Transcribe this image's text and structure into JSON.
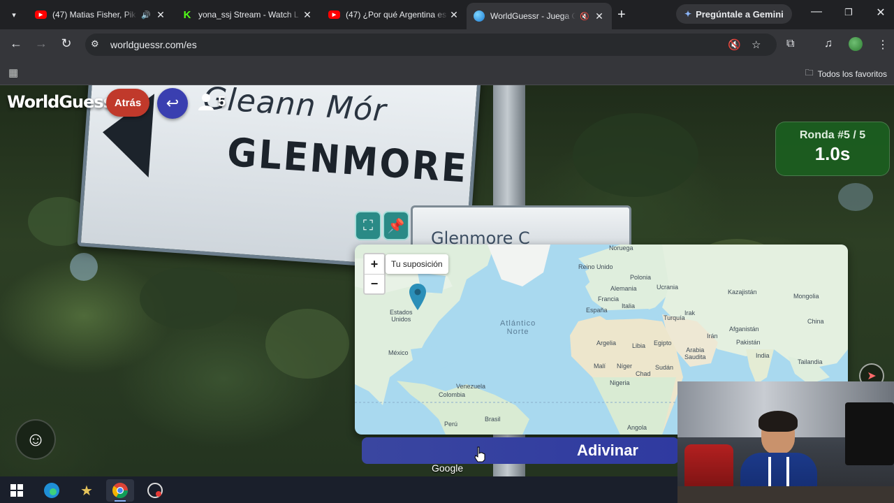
{
  "browser": {
    "tabs": [
      {
        "title": "(47) Matias Fisher, Pik",
        "favicon": "youtube-icon",
        "audio": "speaker-icon"
      },
      {
        "title": "yona_ssj Stream - Watch L",
        "favicon": "kick-icon"
      },
      {
        "title": "(47) ¿Por qué Argentina es",
        "favicon": "youtube-icon"
      },
      {
        "title": "WorldGuessr - Juega G",
        "favicon": "globe-icon",
        "audio": "muted-icon",
        "active": true
      }
    ],
    "gemini_label": "Pregúntale a Gemini",
    "url": "worldguessr.com/es",
    "bookmarks_all": "Todos los favoritos"
  },
  "game": {
    "logo": "WorldGuessr",
    "back_label": "Atrás",
    "players_count": "5",
    "round_label": "Ronda #5 / 5",
    "timer": "1.0s",
    "guess_label": "Adivinar",
    "map_attribution": "Google",
    "map": {
      "tooltip": "Tu suposición",
      "zoom_in": "+",
      "zoom_out": "−",
      "labels": {
        "noruega": "Noruega",
        "reino_unido": "Reino Unido",
        "polonia": "Polonia",
        "alemania": "Alemania",
        "ucrania": "Ucrania",
        "kazajistan": "Kazajistán",
        "mongolia": "Mongolia",
        "francia": "Francia",
        "italia": "Italia",
        "espana": "España",
        "turquia": "Turquía",
        "china": "China",
        "irak": "Irak",
        "iran": "Irán",
        "afganistan": "Afganistán",
        "pakistan": "Pakistán",
        "estados_unidos": "Estados\nUnidos",
        "atlantico_norte": "Atlántico\nNorte",
        "argelia": "Argelia",
        "libia": "Libia",
        "egipto": "Egipto",
        "arabia_saudita": "Arabia\nSaudita",
        "india": "India",
        "tailandia": "Tailandia",
        "mexico": "México",
        "mali": "Malí",
        "niger": "Níger",
        "sudan": "Sudán",
        "chad": "Chad",
        "nigeria": "Nigeria",
        "venezuela": "Venezuela",
        "colombia": "Colombia",
        "brasil": "Brasil",
        "peru": "Perú",
        "angola": "Angola"
      }
    },
    "street_view": {
      "sign_irish": "Gleann Mór",
      "sign_english": "GLENMORE",
      "sign_small": "Glenmore C"
    }
  },
  "colors": {
    "back_button": "#c0392b",
    "undo_button": "#3a3fb0",
    "round_box": "#1b5e20",
    "map_controls": "#2a8a86",
    "guess_bar": "#3a46a0"
  }
}
